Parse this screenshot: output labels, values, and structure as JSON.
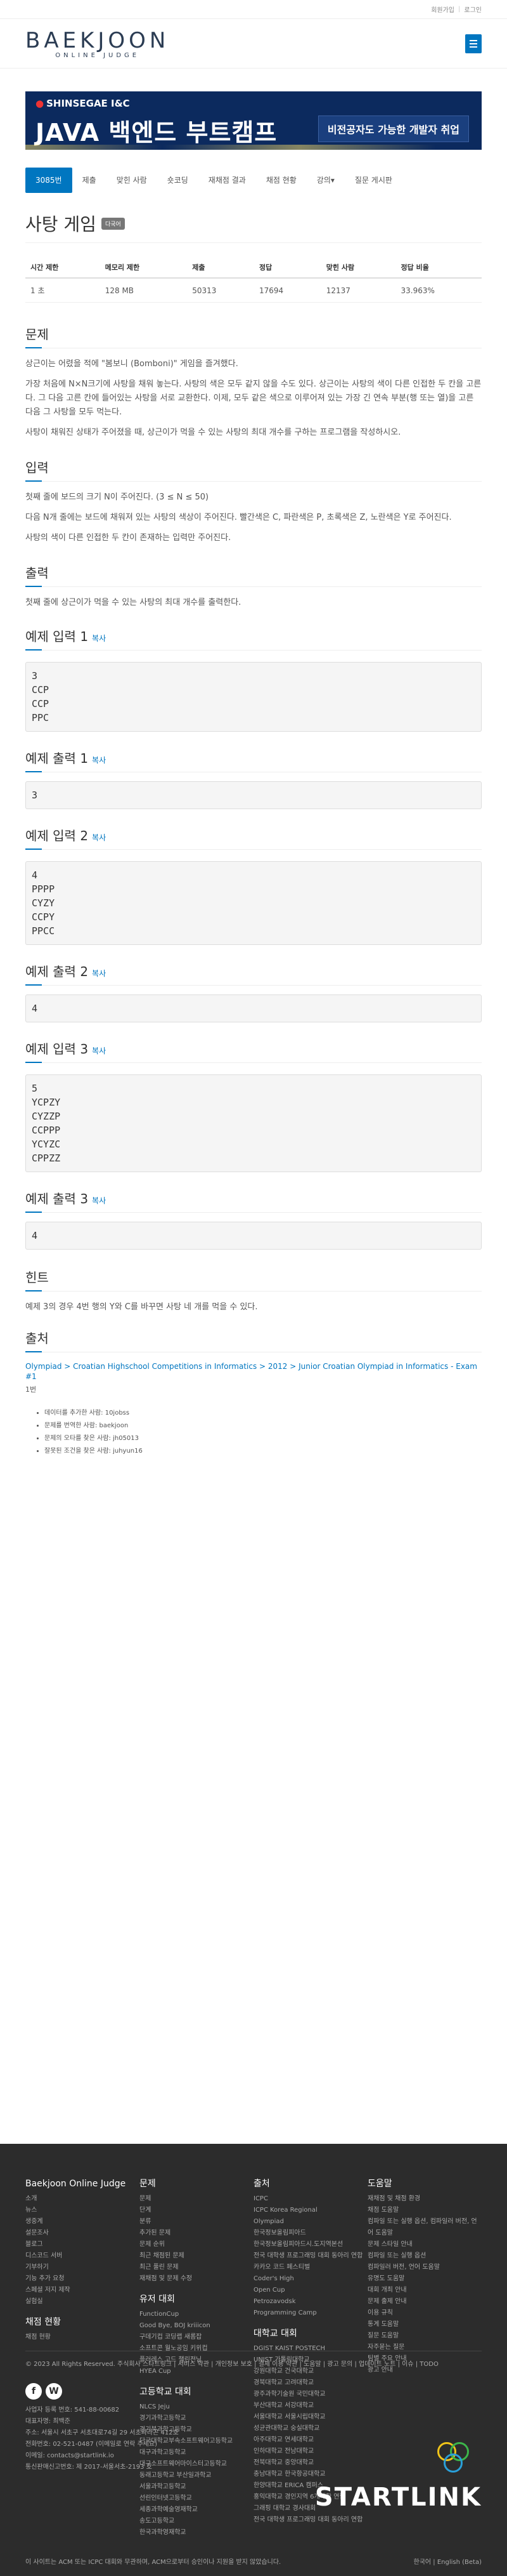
{
  "topbar": {
    "signup": "회원가입",
    "login": "로그인"
  },
  "logo": {
    "main": "BAEKJOON",
    "sub": "ONLINE JUDGE"
  },
  "banner": {
    "brand": "SHINSEGAE I&C",
    "title": "JAVA 백엔드 부트캠프",
    "pill": "비전공자도 가능한 개발자 취업"
  },
  "tabs": [
    "3085번",
    "제출",
    "맞힌 사람",
    "숏코딩",
    "재채점 결과",
    "채점 현황",
    "강의▾",
    "질문 게시판"
  ],
  "problem": {
    "title": "사탕 게임",
    "badge": "다국어",
    "headers": [
      "시간 제한",
      "메모리 제한",
      "제출",
      "정답",
      "맞힌 사람",
      "정답 비율"
    ],
    "row": [
      "1 초",
      "128 MB",
      "50313",
      "17694",
      "12137",
      "33.963%"
    ]
  },
  "sections": {
    "desc_title": "문제",
    "desc": [
      "상근이는 어렸을 적에 \"봄보니 (Bomboni)\" 게임을 즐겨했다.",
      "가장 처음에 N×N크기에 사탕을 채워 놓는다. 사탕의 색은 모두 같지 않을 수도 있다. 상근이는 사탕의 색이 다른 인접한 두 칸을 고른다. 그 다음 고른 칸에 들어있는 사탕을 서로 교환한다. 이제, 모두 같은 색으로 이루어져 있는 가장 긴 연속 부분(행 또는 열)을 고른 다음 그 사탕을 모두 먹는다.",
      "사탕이 채워진 상태가 주어졌을 때, 상근이가 먹을 수 있는 사탕의 최대 개수를 구하는 프로그램을 작성하시오."
    ],
    "input_title": "입력",
    "input": [
      "첫째 줄에 보드의 크기 N이 주어진다. (3 ≤ N ≤ 50)",
      "다음 N개 줄에는 보드에 채워져 있는 사탕의 색상이 주어진다. 빨간색은 C, 파란색은 P, 초록색은 Z, 노란색은 Y로 주어진다.",
      "사탕의 색이 다른 인접한 두 칸이 존재하는 입력만 주어진다."
    ],
    "output_title": "출력",
    "output": [
      "첫째 줄에 상근이가 먹을 수 있는 사탕의 최대 개수를 출력한다."
    ],
    "copy": "복사",
    "samples": [
      {
        "in_title": "예제 입력 1",
        "in": "3\nCCP\nCCP\nPPC",
        "out_title": "예제 출력 1",
        "out": "3"
      },
      {
        "in_title": "예제 입력 2",
        "in": "4\nPPPP\nCYZY\nCCPY\nPPCC",
        "out_title": "예제 출력 2",
        "out": "4"
      },
      {
        "in_title": "예제 입력 3",
        "in": "5\nYCPZY\nCYZZP\nCCPPP\nYCYZC\nCPPZZ",
        "out_title": "예제 출력 3",
        "out": "4"
      }
    ],
    "hint_title": "힌트",
    "hint": "예제 3의 경우 4번 행의 Y와 C를 바꾸면 사탕 네 개를 먹을 수 있다.",
    "source_title": "출처",
    "source_link": "Olympiad > Croatian Highschool Competitions in Informatics > 2012 > Junior Croatian Olympiad in Informatics - Exam #1",
    "source_num": "1번",
    "credits": [
      "데이터를 추가한 사람: 10jobss",
      "문제를 번역한 사람: baekjoon",
      "문제의 오타를 찾은 사람: jh05013",
      "잘못된 조건을 찾은 사람: juhyun16"
    ]
  },
  "footer": {
    "col1_title": "Baekjoon Online Judge",
    "col1": [
      "소개",
      "뉴스",
      "생중계",
      "설문조사",
      "블로그",
      "디스코드 서버",
      "기부하기",
      "기능 추가 요청",
      "스페셜 저지 제작",
      "실험실"
    ],
    "col1b_title": "채점 현황",
    "col1b": [
      "채점 현황"
    ],
    "col2_title": "문제",
    "col2": [
      "문제",
      "단계",
      "분류",
      "추가된 문제",
      "문제 순위",
      "최근 채점된 문제",
      "최근 풀린 문제",
      "재채점 및 문제 수정"
    ],
    "col2b_title": "유저 대회",
    "col2b": [
      "FunctionCup",
      "Good Bye, BOJ kriiicon",
      "구데기컵 코딩랩 새롭잡",
      "소프트콘 월노공임 키위컵",
      "플러레스 고드 챌린전닝",
      "HYEA Cup"
    ],
    "col2c_title": "고등학교 대회",
    "col2c": [
      "NLCS Jeju",
      "경기과학고등학교",
      "경기북과학고등학교",
      "단국대학교부속소프트웨어고등학교",
      "대구과학고등학교",
      "대구소프트웨어마이스터고등학교",
      "동래고등학교 부산일과학교",
      "서울과학고등학교",
      "선린인터넷고등학교",
      "세종과학예술영재학교",
      "송도고등학교",
      "한국과학영재학교"
    ],
    "col3_title": "출처",
    "col3": [
      "ICPC",
      "ICPC Korea Regional",
      "Olympiad",
      "한국정보올림피아드",
      "한국정보올림피아드시.도지역본선",
      "전국 대학생 프로그래밍 대회 동아리 연합",
      "카카오 코드 페스티벌",
      "Coder's High",
      "Open Cup",
      "Petrozavodsk",
      "Programming Camp"
    ],
    "col3b_title": "대학교 대회",
    "col3b": [
      "DGIST KAIST POSTECH",
      "UNIST 가톨릭대학교",
      "강원대학교 건국대학교",
      "경북대학교 고려대학교",
      "광주과학기술원 국민대학교",
      "부산대학교 서강대학교",
      "서울대학교 서울시립대학교",
      "성균관대학교 숭실대학교",
      "아주대학교 연세대학교",
      "인하대학교 전남대학교",
      "전북대학교 중앙대학교",
      "충남대학교 한국항공대학교",
      "한양대학교 ERICA 캠퍼스",
      "홍익대학교 경인지역 6개대학 연합",
      "그래핑 대학교 경사대회",
      "전국 대학생 프로그래밍 대회 동아리 연합"
    ],
    "col4_title": "도움말",
    "col4": [
      "재채점 및 채점 환경",
      "채점 도움말",
      "컴파일 또는 실행 옵션, 컴파일러 버전, 언어 도움말",
      "문제 스타일 안내",
      "컴파일 또는 실행 옵션",
      "컴파일러 버전, 언어 도움말",
      "유명도 도움말",
      "대회 개최 안내",
      "문제 출제 안내",
      "이용 규칙",
      "통계 도움말",
      "질문 도움말",
      "자주묻는 질문",
      "팀별 주요 안내",
      "광고 안내"
    ],
    "bottom_links": "© 2023 All Rights Reserved. 주식회사 스타트링크  |  서비스 약관  |  개인정보 보호  |  결제 이용 약관  |  도움말  |  광고 문의  |  업데이트 노트  |  이슈  |  TODO",
    "biz": [
      "사업자 등록 번호: 541-88-00682",
      "대표자명: 최백준",
      "주소: 서울시 서초구 서초대로74길 29 서초파라곤 412호",
      "전화번호: 02-521-0487 (이메일로 연락 주세요)",
      "이메일: contacts@startlink.io",
      "통신판매신고번호: 제 2017-서울서초-2193 호"
    ],
    "copyright": "이 사이트는 ACM 또는 ICPC 대회와 무관하며, ACM으로부터 승인이나 지원을 받지 않았습니다.",
    "lang": "한국어  |  English (Beta)",
    "startlink": "STARTLINK"
  }
}
